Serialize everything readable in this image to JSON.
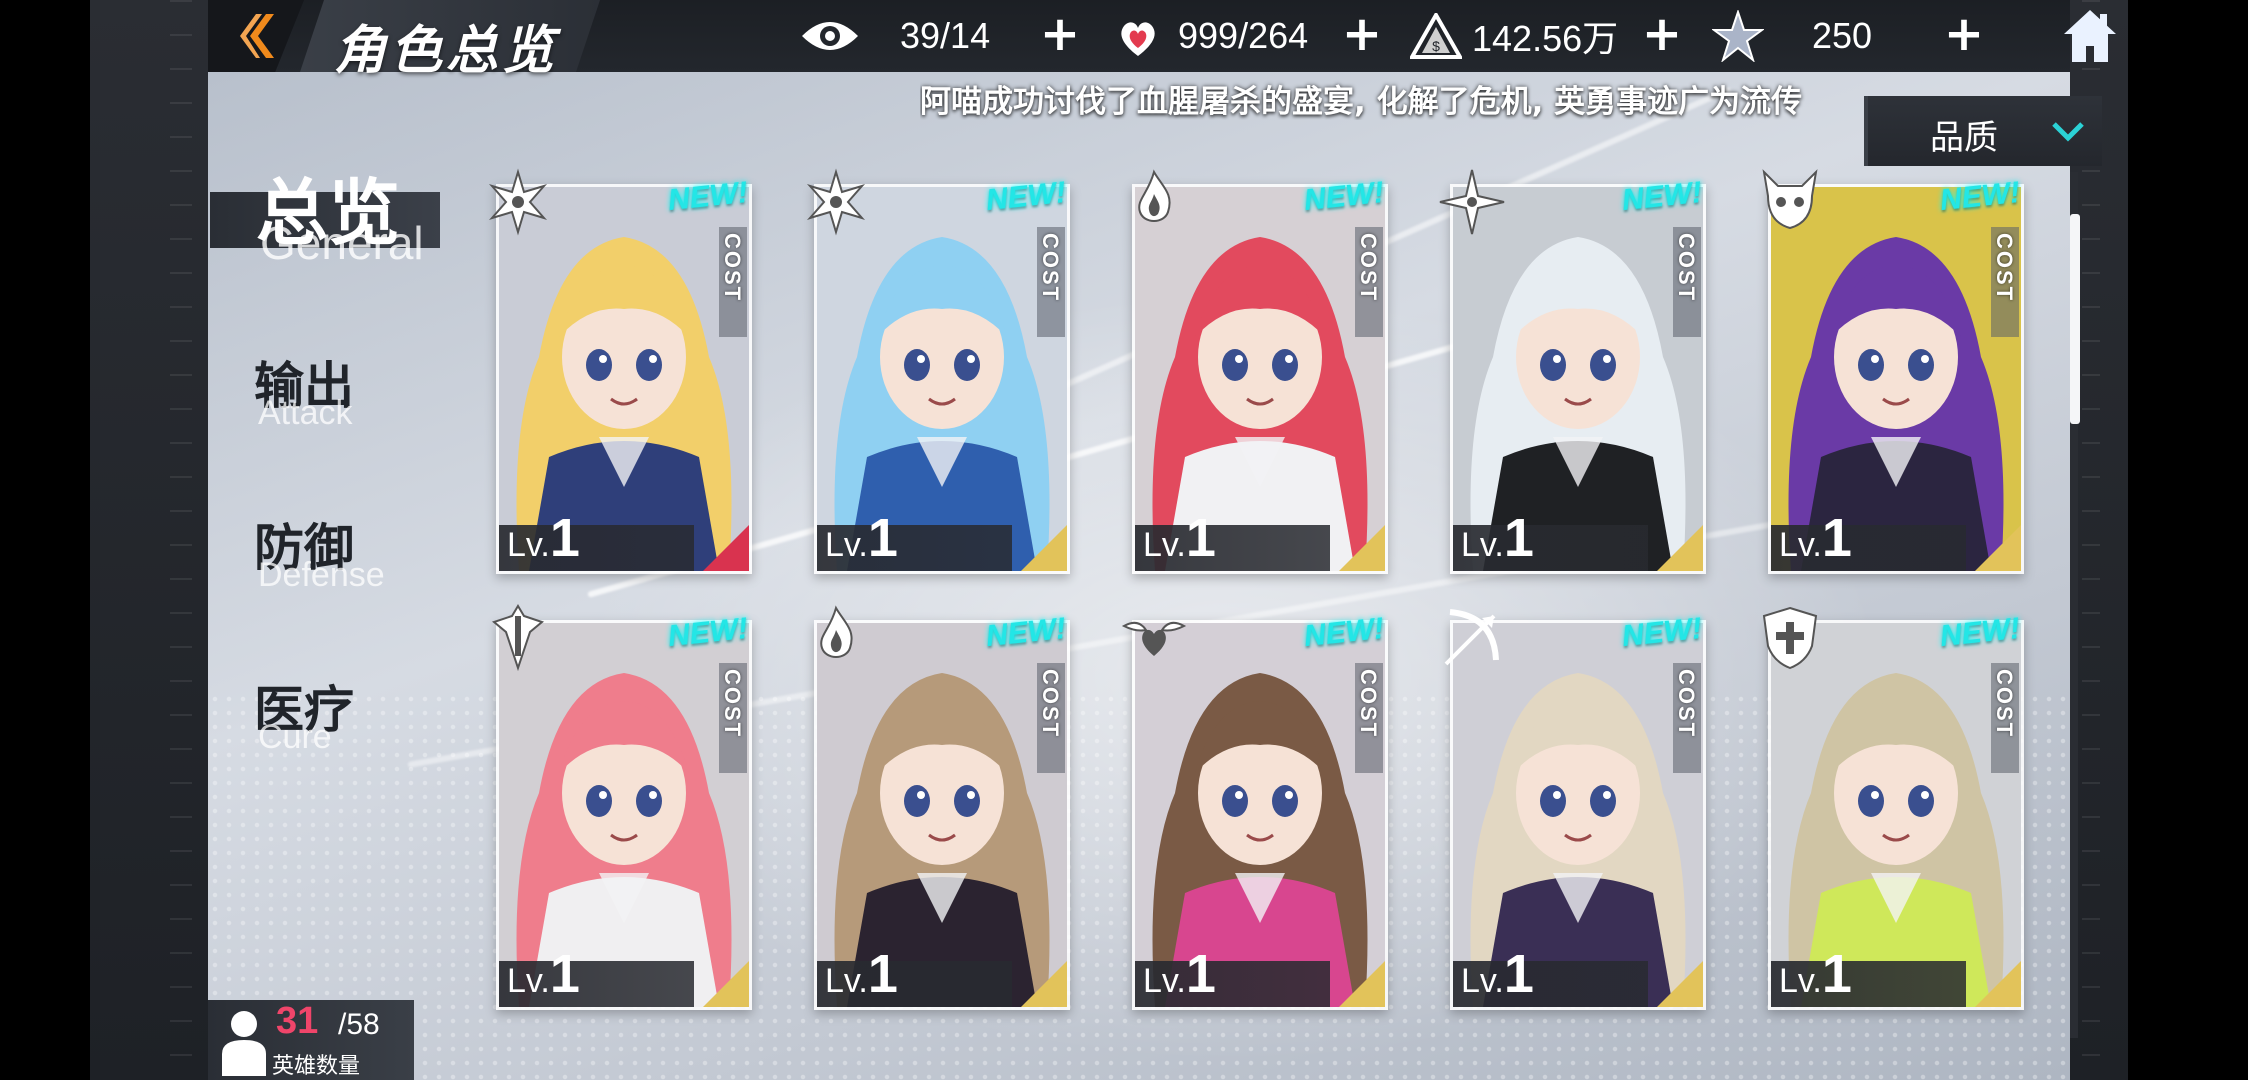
{
  "header": {
    "title": "角色总览",
    "resources": [
      {
        "icon": "eye-icon",
        "value": "39/14"
      },
      {
        "icon": "heart-flame-icon",
        "value": "999/264"
      },
      {
        "icon": "triangle-gem-icon",
        "value": "142.56万"
      },
      {
        "icon": "star-crystal-icon",
        "value": "250"
      }
    ]
  },
  "ticker": {
    "text": "阿喵成功讨伐了血腥屠杀的盛宴, 化解了危机, 英勇事迹广为流传"
  },
  "filter": {
    "label": "品质"
  },
  "sidebar": {
    "items": [
      {
        "zh": "总览",
        "en": "General",
        "active": true
      },
      {
        "zh": "输出",
        "en": "Attack",
        "active": false
      },
      {
        "zh": "防御",
        "en": "Defense",
        "active": false
      },
      {
        "zh": "医疗",
        "en": "Cure",
        "active": false
      }
    ]
  },
  "cards": [
    {
      "class_icon": "flower-icon",
      "level_prefix": "Lv.",
      "level": "1",
      "new": "NEW!",
      "cost": "COST",
      "hair": "#f2cf6a",
      "outfit": "#2f3f7a",
      "bg": "#c9ccd6",
      "corner": "#d9334f"
    },
    {
      "class_icon": "flower-icon",
      "level_prefix": "Lv.",
      "level": "1",
      "new": "NEW!",
      "cost": "COST",
      "hair": "#8fd0f2",
      "outfit": "#2f5fae",
      "bg": "#cfd6e0",
      "corner": "#e2c35a"
    },
    {
      "class_icon": "flame-icon",
      "level_prefix": "Lv.",
      "level": "1",
      "new": "NEW!",
      "cost": "COST",
      "hair": "#e24a5e",
      "outfit": "#f1f1f3",
      "bg": "#d6d0d4",
      "corner": "#e2c35a"
    },
    {
      "class_icon": "shuriken-icon",
      "level_prefix": "Lv.",
      "level": "1",
      "new": "NEW!",
      "cost": "COST",
      "hair": "#e7edf2",
      "outfit": "#1f2124",
      "bg": "#c7ccd2",
      "corner": "#e2c35a"
    },
    {
      "class_icon": "demon-skull-icon",
      "level_prefix": "Lv.",
      "level": "1",
      "new": "NEW!",
      "cost": "COST",
      "hair": "#6a3aa6",
      "outfit": "#2b2540",
      "bg": "#d9c34a",
      "corner": "#e2c35a"
    },
    {
      "class_icon": "sword-emblem-icon",
      "level_prefix": "Lv.",
      "level": "1",
      "new": "NEW!",
      "cost": "COST",
      "hair": "#ef7d8c",
      "outfit": "#f0eff1",
      "bg": "#d2cfd3",
      "corner": "#e2c35a"
    },
    {
      "class_icon": "flame-icon",
      "level_prefix": "Lv.",
      "level": "1",
      "new": "NEW!",
      "cost": "COST",
      "hair": "#b69a7a",
      "outfit": "#2b2330",
      "bg": "#cfcbd1",
      "corner": "#e2c35a"
    },
    {
      "class_icon": "heart-wings-icon",
      "level_prefix": "Lv.",
      "level": "1",
      "new": "NEW!",
      "cost": "COST",
      "hair": "#7a5a45",
      "outfit": "#d8468f",
      "bg": "#d4cfd6",
      "corner": "#e2c35a"
    },
    {
      "class_icon": "bow-arrow-icon",
      "level_prefix": "Lv.",
      "level": "1",
      "new": "NEW!",
      "cost": "COST",
      "hair": "#e2d7c2",
      "outfit": "#3a2f55",
      "bg": "#cfcfd6",
      "corner": "#e2c35a"
    },
    {
      "class_icon": "cross-shield-icon",
      "level_prefix": "Lv.",
      "level": "1",
      "new": "NEW!",
      "cost": "COST",
      "hair": "#cfc4a4",
      "outfit": "#cfe85a",
      "bg": "#d0d2d6",
      "corner": "#e2c35a"
    }
  ],
  "hero_count": {
    "current": "31",
    "max": "/58",
    "label": "英雄数量"
  },
  "colors": {
    "accent_new": "#23e6e6",
    "back_arrow": "#f08a1c",
    "count_red": "#f0456a"
  }
}
